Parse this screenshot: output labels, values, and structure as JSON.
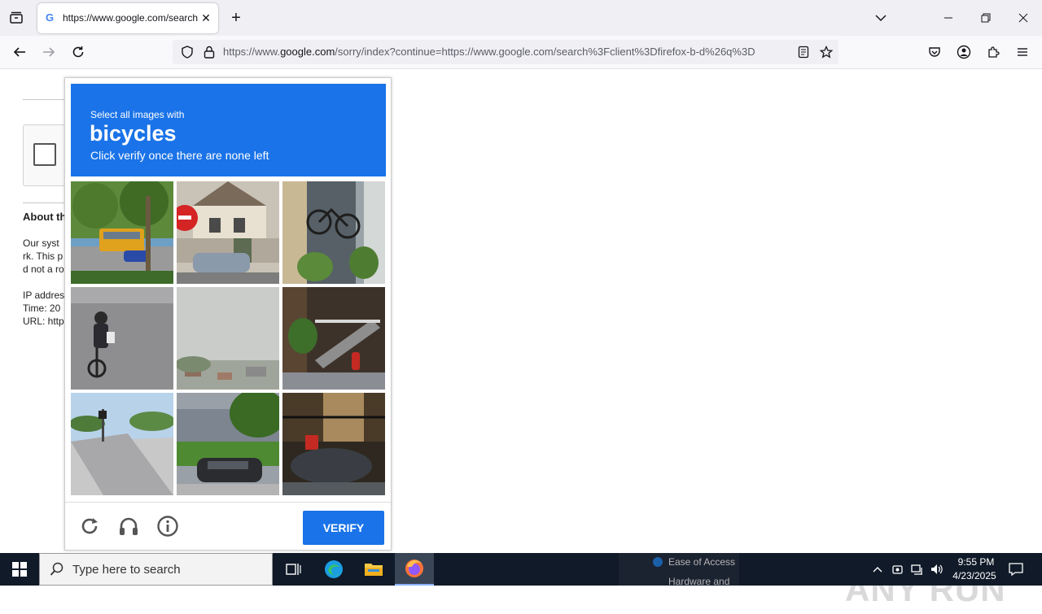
{
  "browser": {
    "tab_title": "https://www.google.com/search",
    "url_prefix": "https://www.",
    "url_domain": "google.com",
    "url_rest": "/sorry/index?continue=https://www.google.com/search%3Fclient%3Dfirefox-b-d%26q%3D"
  },
  "background_page": {
    "about_title": "About th",
    "lines": [
      "Our syst",
      "rk. This p",
      "d not a ro",
      "IP addres",
      "Time: 20",
      "URL: http"
    ]
  },
  "captcha": {
    "line1": "Select all images with",
    "target": "bicycles",
    "line3": "Click verify once there are none left",
    "verify_label": "VERIFY",
    "tiles": [
      "bus-street",
      "no-entry-sign-house",
      "bicycle-behind-column",
      "cyclist-on-road",
      "hazy-sky-town",
      "house-stairs-hydrant",
      "street-crosswalk",
      "cars-under-tree",
      "parked-scooter-fence"
    ]
  },
  "watermark": {
    "text": "ANY RUN"
  },
  "taskbar": {
    "search_placeholder": "Type here to search",
    "bg_window_items": [
      "Ease of Access",
      "Hardware and"
    ],
    "time": "9:55 PM",
    "date": "4/23/2025"
  },
  "colors": {
    "captcha_blue": "#1a73e8",
    "taskbar": "#101a28"
  }
}
